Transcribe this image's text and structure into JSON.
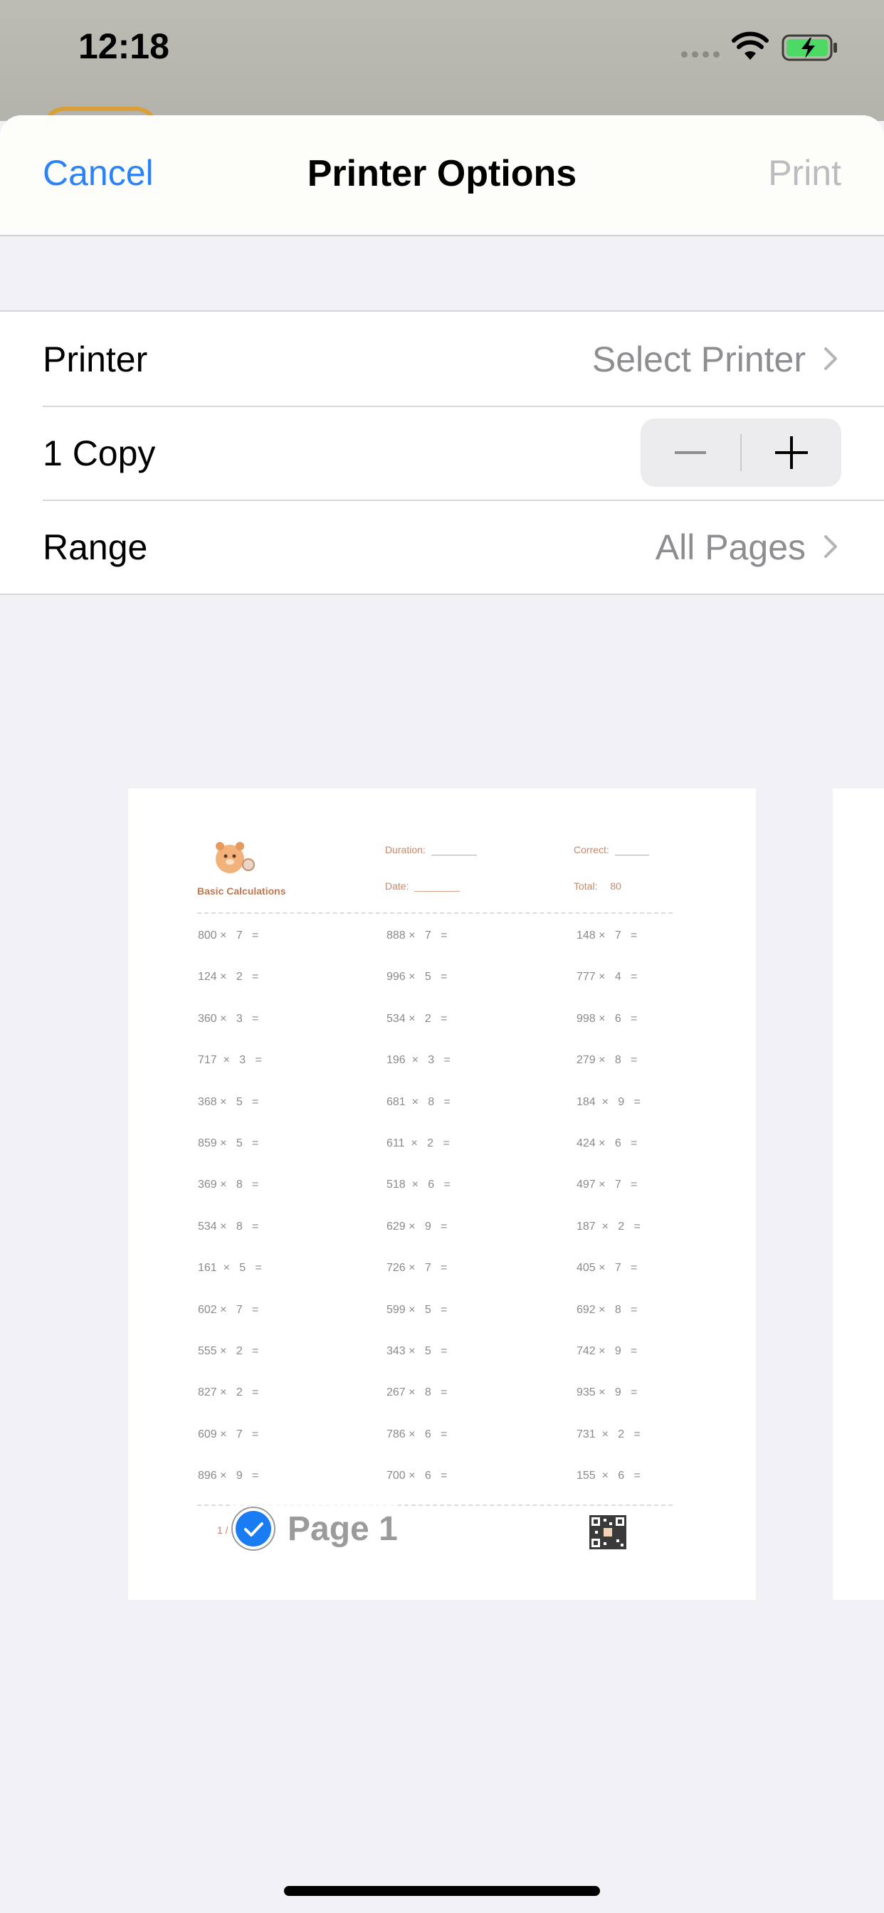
{
  "status_bar": {
    "time": "12:18"
  },
  "nav": {
    "cancel": "Cancel",
    "title": "Printer Options",
    "print": "Print"
  },
  "options": {
    "printer": {
      "label": "Printer",
      "value": "Select Printer"
    },
    "copies": {
      "label": "1 Copy",
      "minus": "−",
      "plus": "+"
    },
    "range": {
      "label": "Range",
      "value": "All Pages"
    }
  },
  "worksheet": {
    "title": "Basic Calculations",
    "duration_label": "Duration:",
    "date_label": "Date:",
    "correct_label": "Correct:",
    "total_label": "Total:",
    "total_value": "80",
    "pager": "1 / 2",
    "columns": [
      [
        "800 ×   7   =",
        "124 ×   2   =",
        "360 ×   3   =",
        "717  ×   3   =",
        "368 ×   5   =",
        "859 ×   5   =",
        "369 ×   8   =",
        "534 ×   8   =",
        "161  ×   5   =",
        "602 ×   7   =",
        "555 ×   2   =",
        "827 ×   2   =",
        "609 ×   7   =",
        "896 ×   9   ="
      ],
      [
        "888 ×   7   =",
        "996 ×   5   =",
        "534 ×   2   =",
        "196  ×   3   =",
        "681  ×   8   =",
        "611  ×   2   =",
        "518  ×   6   =",
        "629 ×   9   =",
        "726 ×   7   =",
        "599 ×   5   =",
        "343 ×   5   =",
        "267 ×   8   =",
        "786 ×   6   =",
        "700 ×   6   ="
      ],
      [
        "148 ×   7   =",
        "777 ×   4   =",
        "998 ×   6   =",
        "279 ×   8   =",
        "184  ×   9   =",
        "424 ×   6   =",
        "497 ×   7   =",
        "187  ×   2   =",
        "405 ×   7   =",
        "692 ×   8   =",
        "742 ×   9   =",
        "935 ×   9   =",
        "731  ×   2   =",
        "155  ×   6   ="
      ]
    ]
  },
  "preview_label": "Page 1",
  "colors": {
    "accent": "#2a84f7",
    "checkbox": "#1a7cf2"
  }
}
